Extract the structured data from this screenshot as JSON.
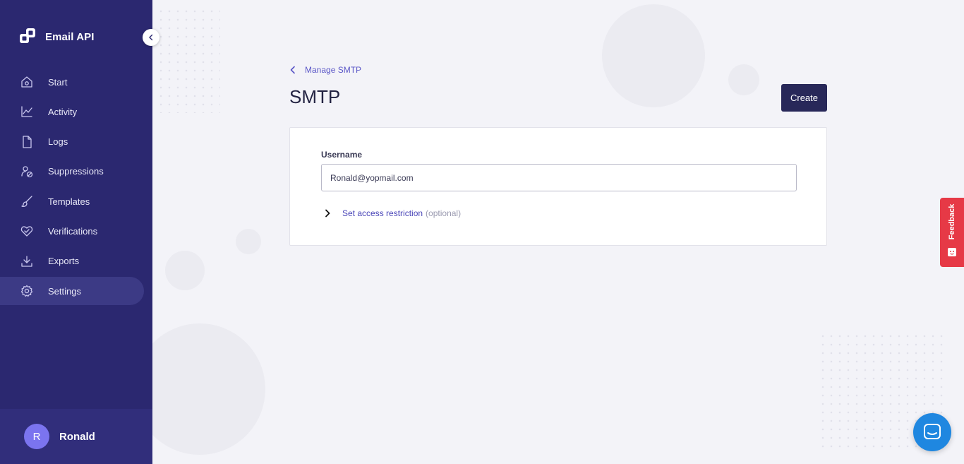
{
  "app": {
    "name": "Email API",
    "logo_icon": "brand-logo-icon"
  },
  "sidebar": {
    "items": [
      {
        "label": "Start",
        "icon": "home-icon",
        "active": false
      },
      {
        "label": "Activity",
        "icon": "chart-line-icon",
        "active": false
      },
      {
        "label": "Logs",
        "icon": "document-icon",
        "active": false
      },
      {
        "label": "Suppressions",
        "icon": "user-block-icon",
        "active": false
      },
      {
        "label": "Templates",
        "icon": "brush-icon",
        "active": false
      },
      {
        "label": "Verifications",
        "icon": "heart-check-icon",
        "active": false
      },
      {
        "label": "Exports",
        "icon": "download-icon",
        "active": false
      },
      {
        "label": "Settings",
        "icon": "gear-icon",
        "active": true
      }
    ],
    "user": {
      "initial": "R",
      "name": "Ronald"
    }
  },
  "main": {
    "back_link": "Manage SMTP",
    "title": "SMTP",
    "create_label": "Create",
    "form": {
      "username_label": "Username",
      "username_value": "Ronald@yopmail.com",
      "restriction_label": "Set access restriction",
      "restriction_optional": "(optional)"
    }
  },
  "widgets": {
    "feedback_label": "Feedback"
  },
  "colors": {
    "sidebar": "#2b2870",
    "sidebar_active": "#3c3a85",
    "primary_button": "#282859",
    "link": "#5b57c7",
    "feedback": "#e63946",
    "chat": "#1f87e0",
    "avatar": "#7b74ef"
  }
}
